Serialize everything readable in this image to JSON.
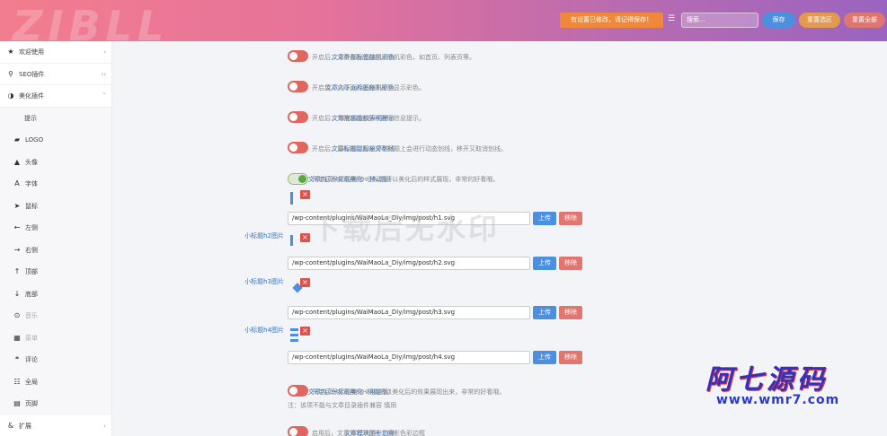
{
  "header": {
    "logo": "ZIBLL",
    "notice": "有设置已修改，请记得保存！",
    "search_placeholder": "搜索...",
    "save": "保存",
    "reset_area": "重置选区",
    "reset_all": "重置全部"
  },
  "sidebar": {
    "items": [
      {
        "icon": "★",
        "label": "欢迎使用",
        "arrow": "›"
      },
      {
        "icon": "⚲",
        "label": "SEO插件",
        "arrow": "‹›"
      },
      {
        "icon": "◑",
        "label": "美化插件",
        "arrow": "˅"
      },
      {
        "icon": "",
        "label": "提示"
      },
      {
        "icon": "▰",
        "label": "LOGO"
      },
      {
        "icon": "▲",
        "label": "头像"
      },
      {
        "icon": "A",
        "label": "字体"
      },
      {
        "icon": "➤",
        "label": "鼠标"
      },
      {
        "icon": "←",
        "label": "左侧"
      },
      {
        "icon": "→",
        "label": "右侧"
      },
      {
        "icon": "↑",
        "label": "顶部"
      },
      {
        "icon": "↓",
        "label": "底部"
      },
      {
        "icon": "⊙",
        "label": "音乐"
      },
      {
        "icon": "▦",
        "label": "菜单"
      },
      {
        "icon": "❝",
        "label": "评论"
      },
      {
        "icon": "☷",
        "label": "全局"
      },
      {
        "icon": "▤",
        "label": "页脚"
      },
      {
        "icon": "&",
        "label": "扩展",
        "arrow": "›"
      }
    ]
  },
  "settings": [
    {
      "label": "文章外部标签随机彩色",
      "state": "off",
      "desc": "开启后，文章页面底部显示随机彩色，如首页、列表页等。"
    },
    {
      "label": "文章内下面标签随机彩色",
      "state": "off",
      "desc": "开启后，文章页内部底下标签显示彩色。"
    },
    {
      "label": "文章底部版权声明提示",
      "state": "off",
      "desc": "开启后，为网站底部版权声明信息提示。"
    },
    {
      "label": "文章标题鼠标悬停划线",
      "state": "off",
      "desc": "开启后，鼠标指针指在文章标题上会进行动态划线，移开又取消划线。"
    },
    {
      "label": "文章内页H标题美化（移动版）",
      "state": "on",
      "desc": "开启后写文章用的H小标题将以美化后的样式展现，非常的好看哦。"
    }
  ],
  "images": [
    {
      "label": "",
      "value": "/wp-content/plugins/WaiMaoLa_Diy/img/post/h1.svg"
    },
    {
      "label": "小标题h2图片",
      "value": "/wp-content/plugins/WaiMaoLa_Diy/img/post/h2.svg"
    },
    {
      "label": "小标题h3图片",
      "value": "/wp-content/plugins/WaiMaoLa_Diy/img/post/h3.svg"
    },
    {
      "label": "小标题h4图片",
      "value": "/wp-content/plugins/WaiMaoLa_Diy/img/post/h4.svg"
    }
  ],
  "upload_label": "上传",
  "remove_label": "移除",
  "bottom": [
    {
      "label": "文章内页H标题美化（电脑版）",
      "state": "off",
      "desc": "开启后写文章用的H标题将以美化后的效果展现出来，非常的好看哦。",
      "note": "注：该项不能与文章目录插件兼容 慎用"
    },
    {
      "label": "文章模块阴影边缘",
      "state": "off",
      "desc": "启用后，文章页将添加一个阴影色彩边框"
    }
  ],
  "watermark": "下载后无水印",
  "stamp": {
    "line1": "阿七源码",
    "line2": "www.wmr7.com"
  }
}
